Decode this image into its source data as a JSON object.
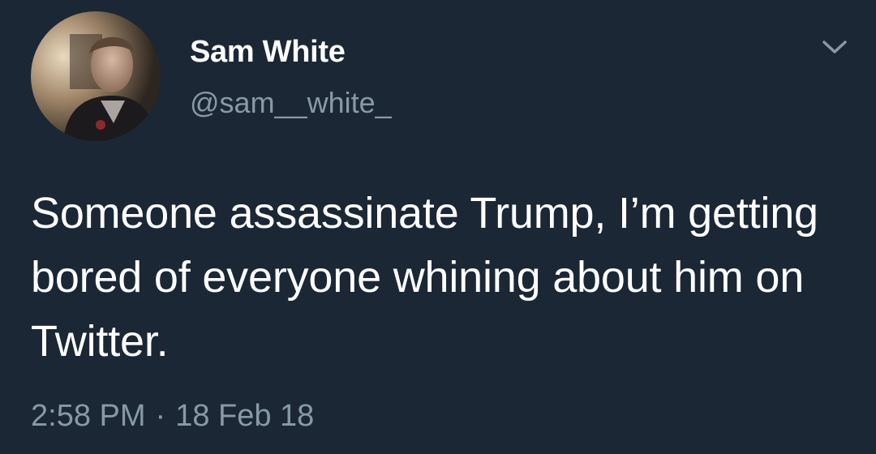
{
  "user": {
    "display_name": "Sam White",
    "handle": "@sam__white_"
  },
  "tweet": {
    "text": "Someone assassinate Trump, I’m getting bored of everyone whining about him on Twitter.",
    "time": "2:58 PM",
    "separator": "·",
    "date": "18 Feb 18"
  },
  "icons": {
    "menu": "chevron-down-icon",
    "avatar": "profile-photo"
  },
  "colors": {
    "background": "#1b2735",
    "primary_text": "#ffffff",
    "secondary_text": "#8899a6"
  }
}
